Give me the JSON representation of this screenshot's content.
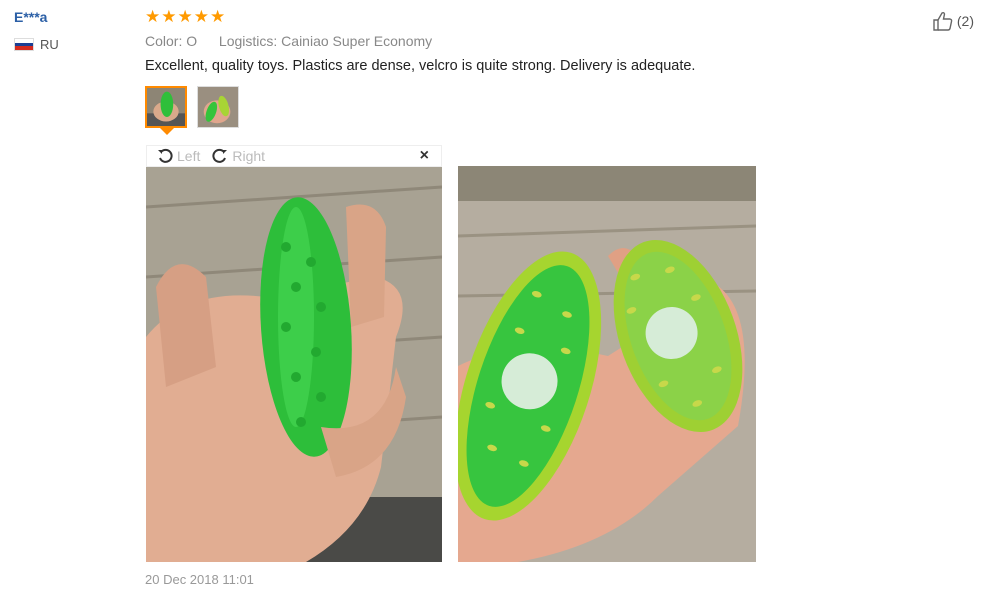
{
  "review": {
    "user": "E***a",
    "country": "RU",
    "rating": 5,
    "color_label": "Color:",
    "color_value": "O",
    "logistics_label": "Logistics:",
    "logistics_value": "Cainiao Super Economy",
    "text": "Excellent, quality toys. Plastics are dense, velcro is quite strong. Delivery is adequate.",
    "date": "20 Dec 2018 11:01",
    "likes": "(2)"
  },
  "viewer": {
    "rotate_left": "Left",
    "rotate_right": "Right",
    "close": "×"
  },
  "icons": {
    "star": "star-icon",
    "like": "thumbs-up-icon",
    "rotate_left": "rotate-left-icon",
    "rotate_right": "rotate-right-icon",
    "close": "close-icon",
    "flag": "russia-flag-icon"
  },
  "colors": {
    "username": "#2b5fa6",
    "star": "#ff9a00",
    "selected_border": "#ff8a00"
  }
}
